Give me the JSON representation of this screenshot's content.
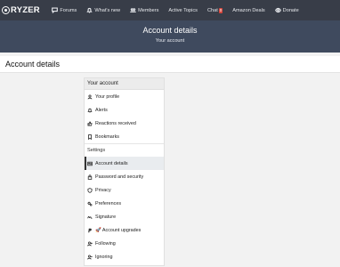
{
  "app": {
    "logo_text": "RYZER"
  },
  "nav": {
    "items": [
      {
        "label": "Forums",
        "icon": "chat-bubble-icon"
      },
      {
        "label": "What's new",
        "icon": "bell-icon"
      },
      {
        "label": "Members",
        "icon": "members-icon"
      },
      {
        "label": "Active Topics",
        "icon": ""
      },
      {
        "label": "Chat",
        "icon": "",
        "badge": "0"
      },
      {
        "label": "Amazon Deals",
        "icon": ""
      },
      {
        "label": "Donate",
        "icon": "eye-icon"
      }
    ]
  },
  "header": {
    "title": "Account details",
    "subtitle": "Your account"
  },
  "page": {
    "title": "Account details"
  },
  "sidebar": {
    "heading": "Your account",
    "group1": [
      {
        "label": "Your profile",
        "icon": "user-icon"
      },
      {
        "label": "Alerts",
        "icon": "bell-icon"
      },
      {
        "label": "Reactions received",
        "icon": "thumbs-up-icon"
      },
      {
        "label": "Bookmarks",
        "icon": "bookmark-icon"
      }
    ],
    "settings_label": "Settings",
    "group2": [
      {
        "label": "Account details",
        "icon": "id-card-icon",
        "active": true
      },
      {
        "label": "Password and security",
        "icon": "lock-icon"
      },
      {
        "label": "Privacy",
        "icon": "shield-icon"
      },
      {
        "label": "Preferences",
        "icon": "gears-icon"
      },
      {
        "label": "Signature",
        "icon": "signature-icon"
      },
      {
        "label": "🚀 Account upgrades",
        "icon": "paypal-icon"
      },
      {
        "label": "Following",
        "icon": "user-plus-icon"
      },
      {
        "label": "Ignoring",
        "icon": "user-minus-icon"
      }
    ]
  },
  "colors": {
    "topbar": "#383d48",
    "header": "#3f4a5e",
    "badge": "#d8473d",
    "page_bg": "#f2f2f2"
  }
}
